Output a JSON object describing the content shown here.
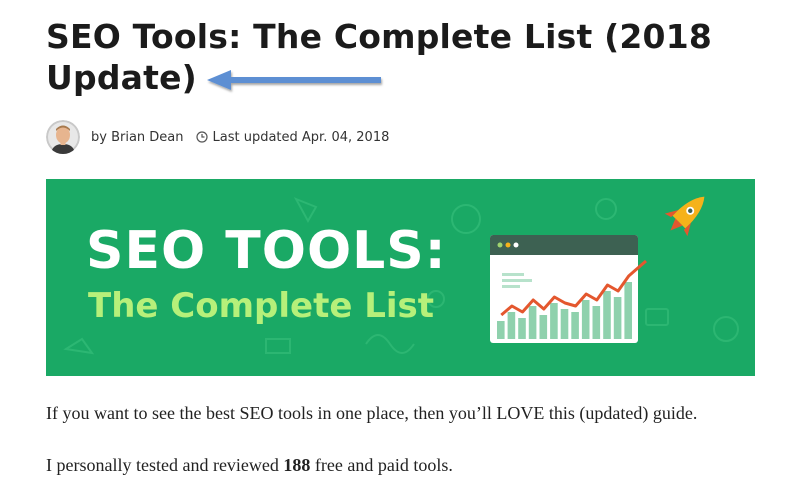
{
  "article": {
    "title_line1": "SEO Tools: The Complete List (2018",
    "title_line2": "Update)",
    "author": "by Brian Dean",
    "updated": "Last updated Apr. 04, 2018"
  },
  "banner": {
    "title": "SEO TOOLS:",
    "subtitle": "The Complete List",
    "bar_levels": [
      0.3,
      0.45,
      0.35,
      0.55,
      0.4,
      0.6,
      0.5,
      0.45,
      0.65,
      0.55,
      0.8,
      0.7,
      0.95
    ],
    "colors": {
      "background": "#1aa965",
      "subtitle": "#b6f07a",
      "rocket": "#f5b21a",
      "trend_line": "#e4572e"
    }
  },
  "body": {
    "paragraph1": "If you want to see the best SEO tools in one place, then you’ll LOVE this (updated) guide.",
    "paragraph2_before": "I personally tested and reviewed ",
    "paragraph2_bold": "188",
    "paragraph2_after": " free and paid tools."
  },
  "icons": {
    "arrow": "left-arrow-icon",
    "clock": "clock-icon",
    "rocket": "rocket-icon"
  }
}
